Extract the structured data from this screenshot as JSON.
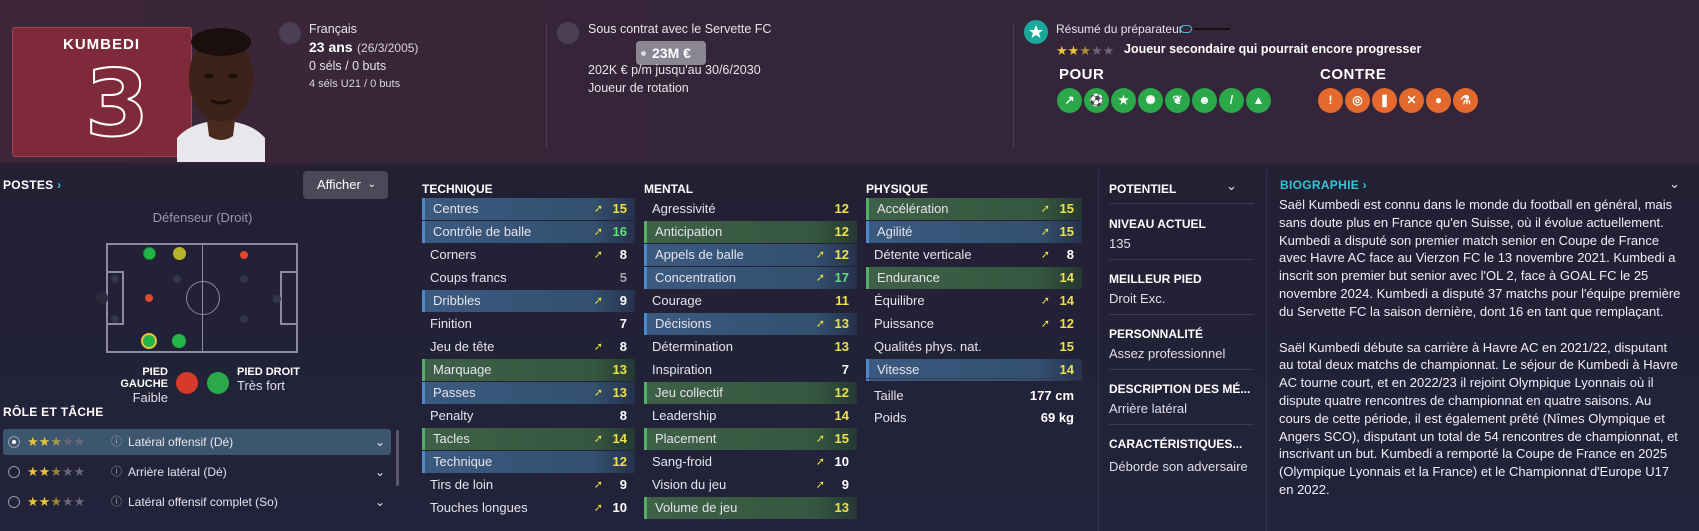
{
  "player": {
    "name": "KUMBEDI",
    "number": "3",
    "nationality": "Français",
    "age": "23 ans",
    "dob": "(26/3/2005)",
    "caps": "0 séls / 0 buts",
    "u21": "4 séls U21 / 0 buts"
  },
  "contract": {
    "title": "Sous contrat avec le Servette FC",
    "value": "23M €",
    "wage": "202K € p/m jusqu'au 30/6/2030",
    "status": "Joueur de rotation"
  },
  "coach": {
    "title": "Résumé du préparateur",
    "stars_filled": 2.5,
    "stars_total": 5,
    "summary": "Joueur secondaire qui pourrait encore progresser",
    "pour": "POUR",
    "contre": "CONTRE",
    "pour_icons": [
      "trend-icon",
      "boot-icon",
      "star-icon",
      "lightbulb-icon",
      "leaf-icon",
      "head-icon",
      "pill-icon",
      "flame-icon"
    ],
    "contre_icons": [
      "ball-icon",
      "target-icon",
      "foot-icon",
      "chain-icon",
      "bolt-icon",
      "flask-icon"
    ],
    "accent_green": "#2aa84a",
    "accent_orange": "#e36a2c"
  },
  "positions": {
    "title": "POSTES",
    "btn": "Afficher",
    "main": "Défenseur (Droit)",
    "left_foot_label": "PIED GAUCHE",
    "left_foot_value": "Faible",
    "right_foot_label": "PIED DROIT",
    "right_foot_value": "Très fort"
  },
  "roles": {
    "title": "RÔLE ET TÂCHE",
    "items": [
      {
        "label": "Latéral offensif (Dé)",
        "stars": 2.5
      },
      {
        "label": "Arrière latéral (Dé)",
        "stars": 2.5
      },
      {
        "label": "Latéral offensif complet (So)",
        "stars": 2.5
      }
    ]
  },
  "attributes": {
    "technique_title": "TECHNIQUE",
    "mental_title": "MENTAL",
    "physique_title": "PHYSIQUE",
    "technique": [
      {
        "name": "Centres",
        "value": "15",
        "arrow": true,
        "hl": "blue",
        "color": "y"
      },
      {
        "name": "Contrôle de balle",
        "value": "16",
        "arrow": true,
        "hl": "blue",
        "color": "g"
      },
      {
        "name": "Corners",
        "value": "8",
        "arrow": true,
        "hl": "",
        "color": "w"
      },
      {
        "name": "Coups francs",
        "value": "5",
        "arrow": false,
        "hl": "",
        "color": "gr"
      },
      {
        "name": "Dribbles",
        "value": "9",
        "arrow": true,
        "hl": "blue",
        "color": "w"
      },
      {
        "name": "Finition",
        "value": "7",
        "arrow": false,
        "hl": "",
        "color": "w"
      },
      {
        "name": "Jeu de tête",
        "value": "8",
        "arrow": true,
        "hl": "",
        "color": "w"
      },
      {
        "name": "Marquage",
        "value": "13",
        "arrow": false,
        "hl": "green",
        "color": "y"
      },
      {
        "name": "Passes",
        "value": "13",
        "arrow": true,
        "hl": "blue",
        "color": "y"
      },
      {
        "name": "Penalty",
        "value": "8",
        "arrow": false,
        "hl": "",
        "color": "w"
      },
      {
        "name": "Tacles",
        "value": "14",
        "arrow": true,
        "hl": "green",
        "color": "y"
      },
      {
        "name": "Technique",
        "value": "12",
        "arrow": false,
        "hl": "blue",
        "color": "y"
      },
      {
        "name": "Tirs de loin",
        "value": "9",
        "arrow": true,
        "hl": "",
        "color": "w"
      },
      {
        "name": "Touches longues",
        "value": "10",
        "arrow": true,
        "hl": "",
        "color": "w"
      }
    ],
    "mental": [
      {
        "name": "Agressivité",
        "value": "12",
        "arrow": false,
        "hl": "",
        "color": "y"
      },
      {
        "name": "Anticipation",
        "value": "12",
        "arrow": false,
        "hl": "green",
        "color": "y"
      },
      {
        "name": "Appels de balle",
        "value": "12",
        "arrow": true,
        "hl": "blue",
        "color": "y"
      },
      {
        "name": "Concentration",
        "value": "17",
        "arrow": true,
        "hl": "blue",
        "color": "g"
      },
      {
        "name": "Courage",
        "value": "11",
        "arrow": false,
        "hl": "",
        "color": "y"
      },
      {
        "name": "Décisions",
        "value": "13",
        "arrow": true,
        "hl": "blue",
        "color": "y"
      },
      {
        "name": "Détermination",
        "value": "13",
        "arrow": false,
        "hl": "",
        "color": "y"
      },
      {
        "name": "Inspiration",
        "value": "7",
        "arrow": false,
        "hl": "",
        "color": "w"
      },
      {
        "name": "Jeu collectif",
        "value": "12",
        "arrow": false,
        "hl": "green",
        "color": "y"
      },
      {
        "name": "Leadership",
        "value": "14",
        "arrow": false,
        "hl": "",
        "color": "y"
      },
      {
        "name": "Placement",
        "value": "15",
        "arrow": true,
        "hl": "green",
        "color": "y"
      },
      {
        "name": "Sang-froid",
        "value": "10",
        "arrow": true,
        "hl": "",
        "color": "w"
      },
      {
        "name": "Vision du jeu",
        "value": "9",
        "arrow": true,
        "hl": "",
        "color": "w"
      },
      {
        "name": "Volume de jeu",
        "value": "13",
        "arrow": false,
        "hl": "green",
        "color": "y"
      }
    ],
    "physique": [
      {
        "name": "Accélération",
        "value": "15",
        "arrow": true,
        "hl": "green",
        "color": "y"
      },
      {
        "name": "Agilité",
        "value": "15",
        "arrow": true,
        "hl": "blue",
        "color": "y"
      },
      {
        "name": "Détente verticale",
        "value": "8",
        "arrow": true,
        "hl": "",
        "color": "w"
      },
      {
        "name": "Endurance",
        "value": "14",
        "arrow": false,
        "hl": "green",
        "color": "y"
      },
      {
        "name": "Équilibre",
        "value": "14",
        "arrow": true,
        "hl": "",
        "color": "y"
      },
      {
        "name": "Puissance",
        "value": "12",
        "arrow": true,
        "hl": "",
        "color": "y"
      },
      {
        "name": "Qualités phys. nat.",
        "value": "15",
        "arrow": false,
        "hl": "",
        "color": "y"
      },
      {
        "name": "Vitesse",
        "value": "14",
        "arrow": false,
        "hl": "blue",
        "color": "y"
      }
    ],
    "height_label": "Taille",
    "height_value": "177 cm",
    "weight_label": "Poids",
    "weight_value": "69 kg"
  },
  "potential": {
    "title": "POTENTIEL",
    "current_label": "NIVEAU ACTUEL",
    "current_value": "135",
    "foot_label": "MEILLEUR PIED",
    "foot_value": "Droit Exc.",
    "personality_label": "PERSONNALITÉ",
    "personality_value": "Assez professionnel",
    "desc_label": "DESCRIPTION DES MÉ...",
    "desc_value": "Arrière latéral",
    "traits_label": "CARACTÉRISTIQUES...",
    "traits_value": "Déborde son adversaire"
  },
  "bio": {
    "title": "BIOGRAPHIE",
    "p1": "Saël Kumbedi est connu dans le monde du football en général, mais sans doute plus en France qu'en Suisse, où il évolue actuellement. Kumbedi a disputé son premier match senior en Coupe de France avec Havre AC face au Vierzon FC le 13 novembre 2021. Kumbedi a inscrit son premier but senior avec l'OL 2, face à GOAL FC le 25 novembre 2024. Kumbedi a disputé 37 matchs pour l'équipe première du Servette FC la saison dernière, dont 16 en tant que remplaçant.",
    "p2": "Saël Kumbedi débute sa carrière à Havre AC en 2021/22, disputant au total deux matchs de championnat. Le séjour de Kumbedi à Havre AC tourne court, et en 2022/23 il rejoint Olympique Lyonnais où il dispute quatre rencontres de championnat en quatre saisons. Au cours de cette période, il est également prêté (Nîmes Olympique et Angers SCO), disputant un total de 54 rencontres de championnat, et inscrivant un but. Kumbedi a remporté la Coupe de France en 2025 (Olympique Lyonnais et la France) et le Championnat d'Europe U17 en 2022."
  }
}
